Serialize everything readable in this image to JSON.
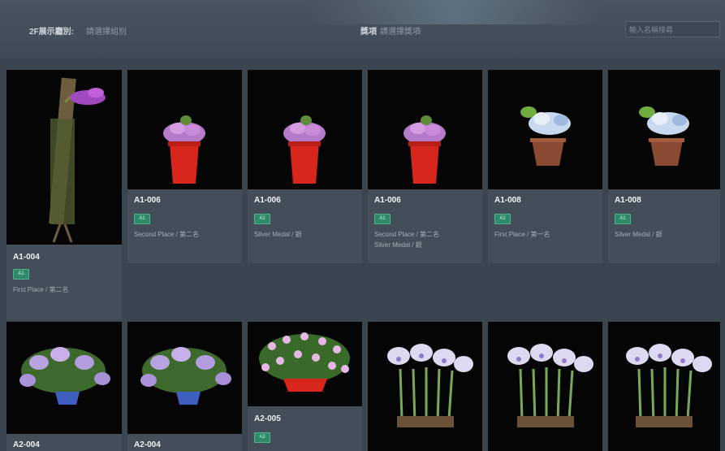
{
  "filters": {
    "group_label": "2F展示廳別:",
    "group_value": "請選擇組別",
    "award_label": "獎項",
    "award_value": "請選擇獎項",
    "search_placeholder": "輸入名稱搜尋"
  },
  "cards": [
    {
      "code": "A1-004",
      "tag": "A1",
      "award": "First Place / 第二名",
      "award2": "",
      "image": "orchid-on-driftwood"
    },
    {
      "code": "A1-006",
      "tag": "A1",
      "award": "Second Place / 第二名",
      "award2": "",
      "image": "pink-orchid-red-pot"
    },
    {
      "code": "A1-006",
      "tag": "A1",
      "award": "Silver Medal / 銀",
      "award2": "",
      "image": "pink-orchid-red-pot"
    },
    {
      "code": "A1-006",
      "tag": "A1",
      "award": "Second Place / 第二名",
      "award2": "Silver Medal / 銀",
      "image": "pink-orchid-red-pot"
    },
    {
      "code": "A1-008",
      "tag": "A1",
      "award": "First Place / 第一名",
      "award2": "",
      "image": "white-orchid-brown-pot"
    },
    {
      "code": "A1-008",
      "tag": "A1",
      "award": "Silver Medal / 銀",
      "award2": "",
      "image": "white-orchid-brown-pot"
    },
    {
      "code": "A2-004",
      "tag": "",
      "award": "",
      "award2": "",
      "image": "lavender-orchid-blue-pot"
    },
    {
      "code": "A2-004",
      "tag": "",
      "award": "",
      "award2": "",
      "image": "lavender-orchid-blue-pot"
    },
    {
      "code": "A2-005",
      "tag": "A2",
      "award": "",
      "award2": "",
      "image": "pink-orchid-basket"
    },
    {
      "code": "",
      "tag": "",
      "award": "",
      "award2": "",
      "image": "cattleya-white"
    },
    {
      "code": "",
      "tag": "",
      "award": "",
      "award2": "",
      "image": "cattleya-white"
    },
    {
      "code": "",
      "tag": "",
      "award": "",
      "award2": "",
      "image": "cattleya-white"
    }
  ]
}
